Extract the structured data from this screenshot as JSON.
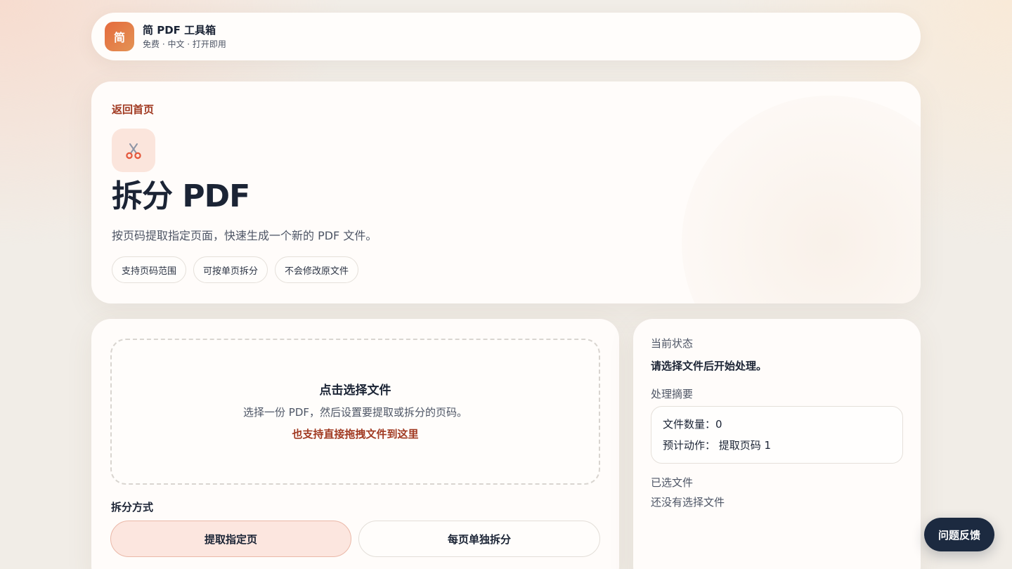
{
  "header": {
    "logo_text": "简",
    "title": "简 PDF 工具箱",
    "subtitle": "免费 · 中文 · 打开即用"
  },
  "hero": {
    "back_label": "返回首页",
    "icon": "scissors-icon",
    "title": "拆分 PDF",
    "description": "按页码提取指定页面，快速生成一个新的 PDF 文件。",
    "chips": [
      "支持页码范围",
      "可按单页拆分",
      "不会修改原文件"
    ]
  },
  "upload": {
    "title": "点击选择文件",
    "description": "选择一份 PDF，然后设置要提取或拆分的页码。",
    "drag_hint": "也支持直接拖拽文件到这里"
  },
  "split_mode": {
    "label": "拆分方式",
    "options": [
      "提取指定页",
      "每页单独拆分"
    ],
    "selected": "提取指定页"
  },
  "sidebar": {
    "status_heading": "当前状态",
    "status_text": "请选择文件后开始处理。",
    "summary_heading": "处理摘要",
    "summary": {
      "file_count": "文件数量：0",
      "planned_action": "预计动作：  提取页码 1"
    },
    "files_heading": "已选文件",
    "files_empty": "还没有选择文件"
  },
  "feedback_label": "问题反馈",
  "colors": {
    "accent": "#a13a22",
    "logo_gradient_start": "#e56b3e",
    "dark": "#1c2a40",
    "active_mode_bg": "#fce6df"
  }
}
